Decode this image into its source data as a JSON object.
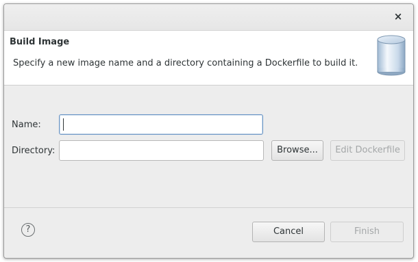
{
  "window": {
    "close_symbol": "×"
  },
  "banner": {
    "title": "Build Image",
    "description": "Specify a new image name and a directory containing a Dockerfile to build it.",
    "icon": "docker-image-cylinder-icon"
  },
  "form": {
    "name_label": "Name:",
    "name_value": "",
    "directory_label": "Directory:",
    "directory_value": "",
    "browse_label": "Browse...",
    "edit_dockerfile_label": "Edit Dockerfile"
  },
  "footer": {
    "help_symbol": "?",
    "cancel_label": "Cancel",
    "finish_label": "Finish"
  },
  "colors": {
    "dialog_bg": "#ededed",
    "banner_bg": "#ffffff",
    "focus_border": "#6d97c6",
    "disabled_text": "#a4a7a8"
  }
}
